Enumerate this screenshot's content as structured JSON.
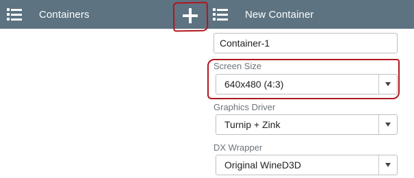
{
  "left_panel": {
    "title": "Containers"
  },
  "right_panel": {
    "title": "New Container",
    "name_field": {
      "value": "Container-1"
    },
    "screen_size": {
      "label": "Screen Size",
      "selected": "640x480 (4:3)"
    },
    "graphics_driver": {
      "label": "Graphics Driver",
      "selected": "Turnip + Zink"
    },
    "dx_wrapper": {
      "label": "DX Wrapper",
      "selected": "Original WineD3D"
    }
  },
  "colors": {
    "appbar": "#5d7381",
    "annotation": "#b0151d"
  },
  "icons": [
    "menu-icon",
    "plus-icon",
    "dropdown-caret-icon"
  ]
}
